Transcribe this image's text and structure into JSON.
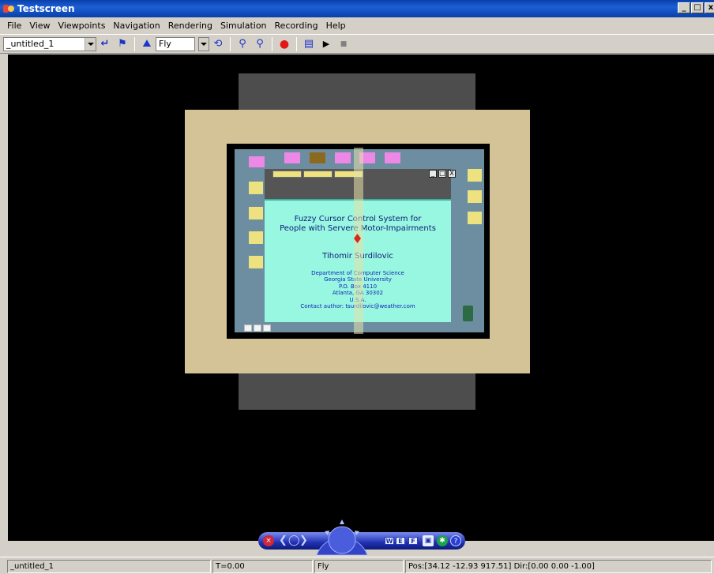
{
  "window": {
    "title": "Testscreen",
    "controls": [
      "_",
      "□",
      "x"
    ]
  },
  "menu": [
    "File",
    "View",
    "Viewpoints",
    "Navigation",
    "Rendering",
    "Simulation",
    "Recording",
    "Help"
  ],
  "toolbar": {
    "viewpoint_select": "_untitled_1",
    "navigation_mode": "Fly",
    "icons": [
      "return-icon",
      "flag-icon",
      "fly-icon",
      "undo-icon",
      "zoom-in-icon",
      "zoom-out-icon",
      "record-icon",
      "clipboard-icon",
      "play-icon",
      "stop-icon"
    ]
  },
  "scene": {
    "slide": {
      "title_line1": "Fuzzy Cursor Control System for",
      "title_line2": "People with Servere Motor-Impairments",
      "author": "Tihomir Surdilovic",
      "info": [
        "Department of Computer Science",
        "Georgia State University",
        "P.O. Box 4110",
        "Atlanta, GA 30302",
        "U.S.A.",
        "Contact author: tsurdilovic@weather.com"
      ]
    },
    "mini_window_controls": [
      "_",
      "□",
      "X"
    ],
    "colors": {
      "background": "#000000",
      "gray_panel": "#4d4d4d",
      "beige_frame": "#d3c397",
      "screen": "#6c8ea0",
      "slide": "#97f7e0",
      "pink_icon": "#ee88e6",
      "yellow_icon": "#ede27f"
    }
  },
  "nav_widget": {
    "keys": [
      "W",
      "E",
      "F"
    ],
    "help": "?"
  },
  "status": {
    "viewpoint": "_untitled_1",
    "time": "T=0.00",
    "mode": "Fly",
    "position": "Pos:[34.12 -12.93 917.51] Dir:[0.00 0.00 -1.00]"
  }
}
